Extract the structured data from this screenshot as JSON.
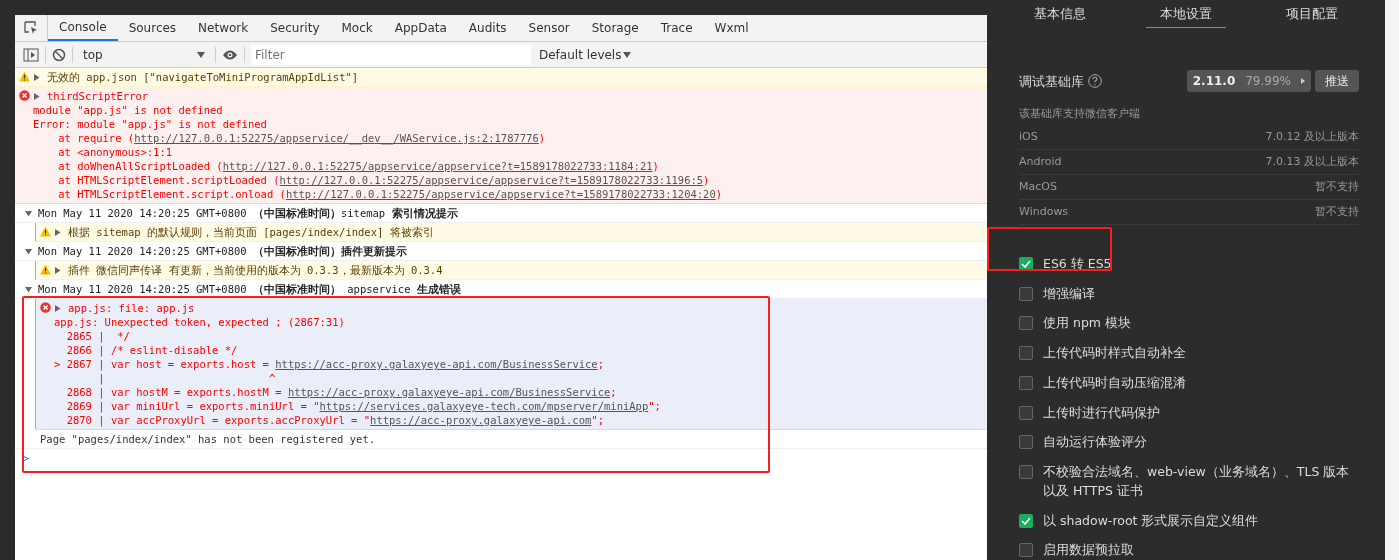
{
  "devtools_tabs": [
    {
      "label": "Console",
      "selected": true
    },
    {
      "label": "Sources",
      "selected": false
    },
    {
      "label": "Network",
      "selected": false
    },
    {
      "label": "Security",
      "selected": false
    },
    {
      "label": "Mock",
      "selected": false
    },
    {
      "label": "AppData",
      "selected": false
    },
    {
      "label": "Audits",
      "selected": false
    },
    {
      "label": "Sensor",
      "selected": false
    },
    {
      "label": "Storage",
      "selected": false
    },
    {
      "label": "Trace",
      "selected": false
    },
    {
      "label": "Wxml",
      "selected": false
    }
  ],
  "toolbar": {
    "context": "top",
    "filter_placeholder": "Filter",
    "levels": "Default levels"
  },
  "messages": [
    {
      "kind": "warning",
      "expanded": false,
      "text": "无效的 app.json [\"navigateToMiniProgramAppIdList\"]"
    },
    {
      "kind": "error",
      "expanded": false,
      "text": "thirdScriptError",
      "lines": [
        {
          "pre": "module \"app.js\" is not defined"
        },
        {
          "pre": "Error: module \"app.js\" is not defined"
        },
        {
          "pre": "    at require (",
          "link": "http://127.0.0.1:52275/appservice/__dev__/WAService.js:2:1787776",
          "post": ")"
        },
        {
          "pre": "    at <anonymous>:1:1"
        },
        {
          "pre": "    at doWhenAllScriptLoaded (",
          "link": "http://127.0.0.1:52275/appservice/appservice?t=1589178022733:1184:21",
          "post": ")"
        },
        {
          "pre": "    at HTMLScriptElement.scriptLoaded (",
          "link": "http://127.0.0.1:52275/appservice/appservice?t=1589178022733:1196:5",
          "post": ")"
        },
        {
          "pre": "    at HTMLScriptElement.script.onload (",
          "link": "http://127.0.0.1:52275/appservice/appservice?t=1589178022733:1204:20",
          "post": ")"
        }
      ]
    },
    {
      "kind": "group",
      "expanded": true,
      "title": "Mon May 11 2020 14:20:25 GMT+0800 **（中国标准时间）**sitemap **索引情况提示**",
      "children": [
        {
          "kind": "warning",
          "expanded": false,
          "text": "根据 sitemap 的默认规则，当前页面 [pages/index/index] 将被索引"
        }
      ]
    },
    {
      "kind": "group",
      "expanded": true,
      "title": "Mon May 11 2020 14:20:25 GMT+0800 **（中国标准时间）插件更新提示**",
      "children": [
        {
          "kind": "warning",
          "expanded": false,
          "text": "插件 微信同声传译 有更新，当前使用的版本为 0.3.3，最新版本为 0.3.4"
        }
      ]
    },
    {
      "kind": "group",
      "expanded": true,
      "annotated": true,
      "title": "Mon May 11 2020 14:20:25 GMT+0800 **（中国标准时间）** appservice **生成错误**",
      "children": [
        {
          "kind": "error",
          "expanded": false,
          "text": "app.js: file: app.js",
          "lines": [
            {
              "pre": "app.js: Unexpected token, expected ; (2867:31)"
            },
            {
              "pre": "  2865 |  */"
            },
            {
              "pre": "  2866 | /* eslint-disable */"
            },
            {
              "pre": "> 2867 | var host = exports.host = ",
              "link": "https://acc-proxy.galaxyeye-api.com/BusinessService",
              "post": ";"
            },
            {
              "pre": "       |                          ^"
            },
            {
              "pre": "  2868 | var hostM = exports.hostM = ",
              "link": "https://acc-proxy.galaxyeye-api.com/BusinessService",
              "post": ";"
            },
            {
              "pre": "  2869 | var miniUrl = exports.miniUrl = \"",
              "link": "https://services.galaxyeye-tech.com/mpserver/miniApp",
              "post": "\";"
            },
            {
              "pre": "  2870 | var accProxyUrl = exports.accProxyUrl = \"",
              "link": "https://acc-proxy.galaxyeye-api.com",
              "post": "\";"
            }
          ]
        }
      ]
    },
    {
      "kind": "log",
      "text": "Page \"pages/index/index\" has not been registered yet."
    },
    {
      "kind": "prompt",
      "text": ">"
    }
  ],
  "settings_tabs": [
    {
      "label": "基本信息",
      "selected": false
    },
    {
      "label": "本地设置",
      "selected": true
    },
    {
      "label": "项目配置",
      "selected": false
    }
  ],
  "base_library": {
    "label": "调试基础库",
    "version": "2.11.0",
    "coverage": "79.99%",
    "button": "推送",
    "support_title": "该基础库支持微信客户端",
    "platforms": [
      {
        "name": "iOS",
        "value": "7.0.12 及以上版本"
      },
      {
        "name": "Android",
        "value": "7.0.13 及以上版本"
      },
      {
        "name": "MacOS",
        "value": "暂不支持"
      },
      {
        "name": "Windows",
        "value": "暂不支持"
      }
    ]
  },
  "options": [
    {
      "label": "ES6 转 ES5",
      "checked": true,
      "annotated": true
    },
    {
      "label": "增强编译",
      "checked": false
    },
    {
      "label": "使用 npm 模块",
      "checked": false
    },
    {
      "label": "上传代码时样式自动补全",
      "checked": false
    },
    {
      "label": "上传代码时自动压缩混淆",
      "checked": false
    },
    {
      "label": "上传时进行代码保护",
      "checked": false
    },
    {
      "label": "自动运行体验评分",
      "checked": false
    },
    {
      "label": "不校验合法域名、web-view（业务域名）、TLS 版本以及 HTTPS 证书",
      "checked": false
    },
    {
      "label": "以 shadow-root 形式展示自定义组件",
      "checked": true
    },
    {
      "label": "启用数据预拉取",
      "checked": false
    }
  ]
}
